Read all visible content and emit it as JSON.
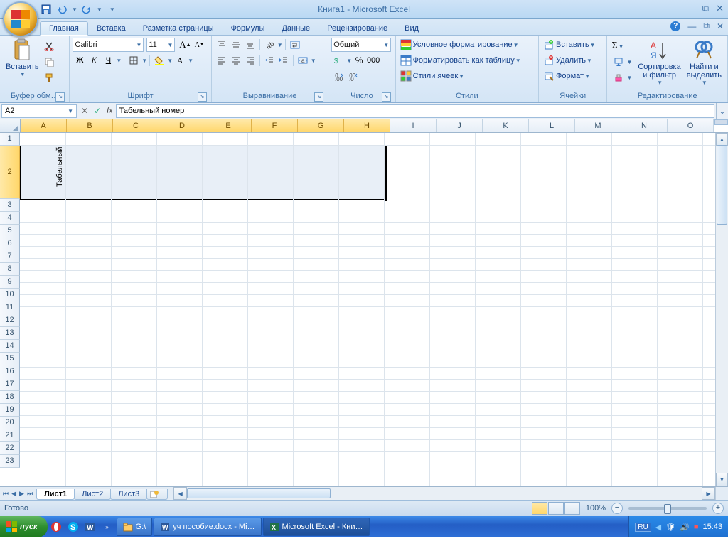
{
  "title": "Книга1 - Microsoft Excel",
  "tabs": {
    "home": "Главная",
    "insert": "Вставка",
    "layout": "Разметка страницы",
    "formulas": "Формулы",
    "data": "Данные",
    "review": "Рецензирование",
    "view": "Вид"
  },
  "ribbon": {
    "clipboard": {
      "paste": "Вставить",
      "label": "Буфер обм…"
    },
    "font": {
      "name": "Calibri",
      "size": "11",
      "bold": "Ж",
      "italic": "К",
      "underline": "Ч",
      "label": "Шрифт"
    },
    "alignment": {
      "label": "Выравнивание"
    },
    "number": {
      "format": "Общий",
      "label": "Число"
    },
    "styles": {
      "cond": "Условное форматирование",
      "table": "Форматировать как таблицу",
      "cells": "Стили ячеек",
      "label": "Стили"
    },
    "cells": {
      "insert": "Вставить",
      "delete": "Удалить",
      "format": "Формат",
      "label": "Ячейки"
    },
    "editing": {
      "sort": "Сортировка\nи фильтр",
      "find": "Найти и\nвыделить",
      "label": "Редактирование"
    }
  },
  "namebox": "A2",
  "formula": "Табельный номер",
  "columns": [
    "A",
    "B",
    "C",
    "D",
    "E",
    "F",
    "G",
    "H",
    "I",
    "J",
    "K",
    "L",
    "M",
    "N",
    "O"
  ],
  "rows_std": [
    "1"
  ],
  "rows_tall": [
    "2"
  ],
  "rows_rest": [
    "3",
    "4",
    "5",
    "6",
    "7",
    "8",
    "9",
    "10",
    "11",
    "12",
    "13",
    "14",
    "15",
    "16",
    "17",
    "18",
    "19",
    "20",
    "21",
    "22",
    "23"
  ],
  "cell_a2": "Табельный",
  "sheets": {
    "s1": "Лист1",
    "s2": "Лист2",
    "s3": "Лист3"
  },
  "status": {
    "ready": "Готово",
    "zoom": "100%"
  },
  "taskbar": {
    "start": "пуск",
    "drive": "G:\\",
    "word": "уч пособие.docx - Mi…",
    "excel": "Microsoft Excel - Кни…",
    "lang": "RU",
    "time": "15:43"
  }
}
